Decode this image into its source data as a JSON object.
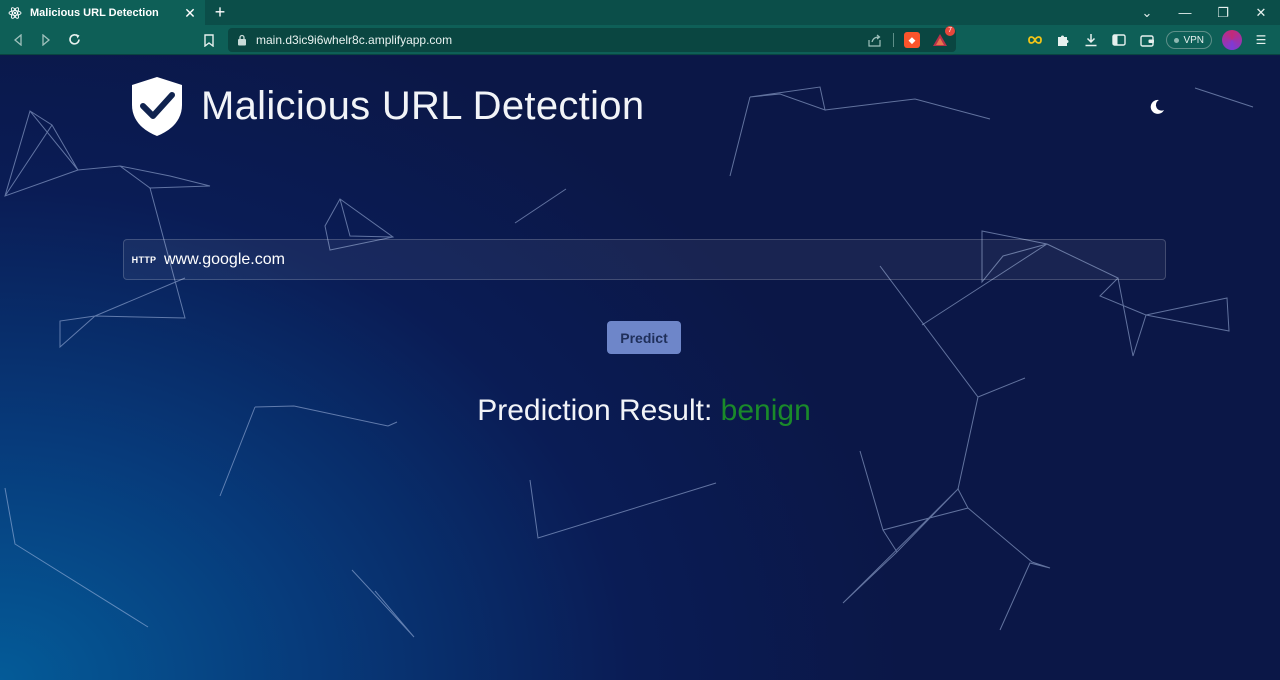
{
  "browser": {
    "tab_title": "Malicious URL Detection",
    "address": "main.d3ic9i6whelr8c.amplifyapp.com",
    "rewards_badge": "7",
    "vpn_label": "VPN"
  },
  "app": {
    "title": "Malicious URL Detection",
    "url_prefix": "HTTP",
    "url_value": "www.google.com",
    "predict_label": "Predict",
    "result_label": "Prediction Result:",
    "result_value": "benign"
  },
  "colors": {
    "tab_bar": "#0b4e49",
    "toolbar": "#0e5f57",
    "page_bg": "#0b1747",
    "button": "#6e86c9",
    "result_value": "#1a8a2a"
  },
  "icons": {
    "tab_favicon": "react-atom-icon",
    "logo": "shield-check-icon",
    "theme": "moon-icon"
  }
}
